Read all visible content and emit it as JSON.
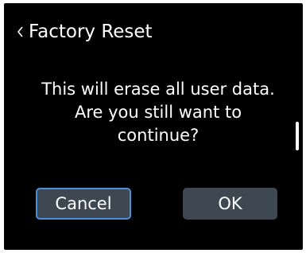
{
  "header": {
    "back_icon": "chevron-left-icon",
    "title": "Factory Reset"
  },
  "dialog": {
    "message_lines": [
      "This will erase all user data.",
      "Are you still want to",
      "continue?"
    ]
  },
  "buttons": {
    "cancel_label": "Cancel",
    "ok_label": "OK",
    "focused": "Cancel"
  },
  "colors": {
    "background": "#000000",
    "text": "#ffffff",
    "button_bg": "#3d4852",
    "focus_border": "#4a90d9"
  }
}
